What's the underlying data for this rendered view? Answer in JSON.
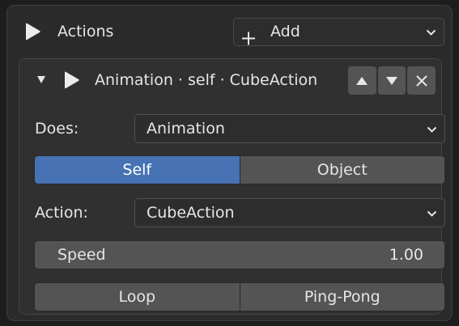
{
  "header": {
    "title": "Actions",
    "add_label": "Add",
    "play_icon": "play-icon",
    "plus_icon": "plus-icon"
  },
  "panel": {
    "title": "Animation · self · CubeAction",
    "collapse_icon": "disclosure-triangle-down-icon",
    "buttons": [
      "move-up",
      "move-down",
      "remove"
    ]
  },
  "does": {
    "label": "Does:",
    "value": "Animation"
  },
  "target_toggle": {
    "options": [
      "Self",
      "Object"
    ],
    "selected": "Self"
  },
  "action": {
    "label": "Action:",
    "value": "CubeAction"
  },
  "speed": {
    "label": "Speed",
    "value": "1.00"
  },
  "playback_toggle": {
    "options": [
      "Loop",
      "Ping-Pong"
    ]
  },
  "colors": {
    "background": "#1d1d1d",
    "panel": "#303030",
    "button": "#545454",
    "active": "#4772b3",
    "text": "#e6e6e6"
  }
}
